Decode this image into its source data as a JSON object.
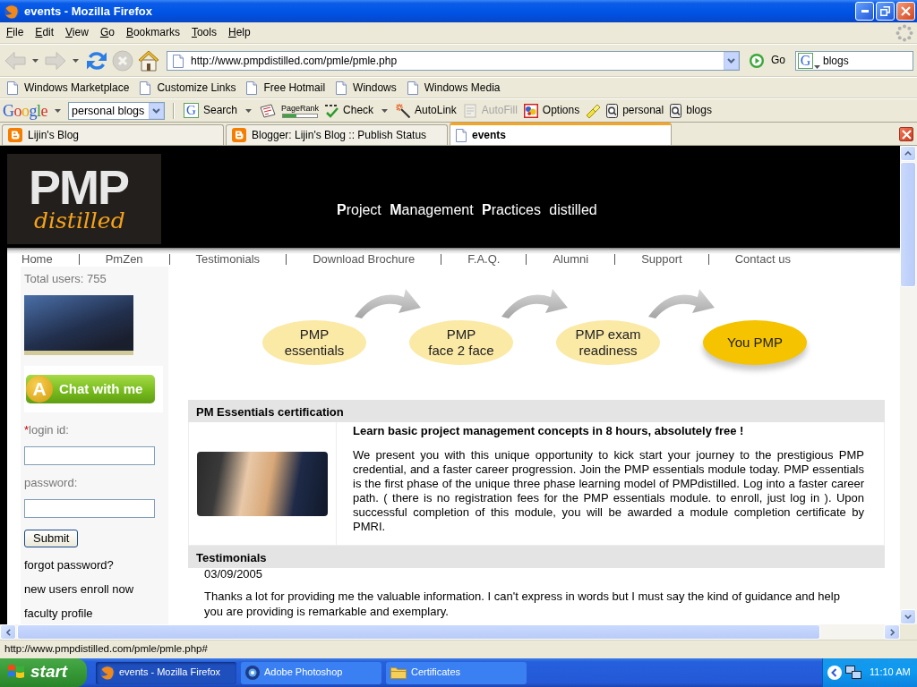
{
  "window": {
    "title": "events - Mozilla Firefox"
  },
  "menu": [
    "File",
    "Edit",
    "View",
    "Go",
    "Bookmarks",
    "Tools",
    "Help"
  ],
  "nav_toolbar": {
    "buttons": [
      {
        "kind": "back",
        "disabled": true,
        "dropdown": true
      },
      {
        "kind": "forward",
        "disabled": true,
        "dropdown": true
      },
      {
        "kind": "reload",
        "disabled": false,
        "dropdown": false
      },
      {
        "kind": "stop",
        "disabled": true,
        "dropdown": false
      },
      {
        "kind": "home",
        "disabled": false,
        "dropdown": false
      }
    ],
    "url": "http://www.pmpdistilled.com/pmle/pmle.php",
    "go": "Go",
    "search": {
      "engine": "G",
      "value": "blogs"
    }
  },
  "bookmarks": [
    "Windows Marketplace",
    "Customize Links",
    "Free Hotmail",
    "Windows",
    "Windows Media"
  ],
  "google_toolbar": {
    "logo": "Google",
    "query": "personal blogs",
    "items": [
      {
        "kind": "search",
        "badge": "G",
        "label": "Search",
        "dropdown": true,
        "disabled": false
      },
      {
        "kind": "news",
        "dropdown": false,
        "disabled": false
      },
      {
        "kind": "pagerank",
        "label": "PageRank",
        "level": 0.4,
        "dropdown": false,
        "disabled": false
      },
      {
        "kind": "spellcheck",
        "label": "Check",
        "dropdown": true,
        "disabled": false
      },
      {
        "kind": "autolink",
        "label": "AutoLink",
        "dropdown": false,
        "disabled": false
      },
      {
        "kind": "autofill",
        "label": "AutoFill",
        "dropdown": false,
        "disabled": true
      },
      {
        "kind": "options",
        "label": "Options",
        "dropdown": false,
        "disabled": false
      },
      {
        "kind": "highlight",
        "dropdown": false,
        "disabled": false
      },
      {
        "kind": "word",
        "label": "personal",
        "dropdown": false,
        "disabled": false
      },
      {
        "kind": "word",
        "label": "blogs",
        "dropdown": false,
        "disabled": false
      }
    ]
  },
  "tabs": [
    {
      "kind": "blog",
      "label": "Lijin's Blog",
      "selected": false
    },
    {
      "kind": "blog",
      "label": "Blogger: Lijin's Blog :: Publish Status",
      "selected": false
    },
    {
      "kind": "page",
      "label": "events",
      "selected": true
    }
  ],
  "page": {
    "logo": {
      "mark": "PMP",
      "script": "distilled"
    },
    "tagline": "**P**roject **M**anagement **P**ractices distilled",
    "nav": [
      "Home",
      "PmZen",
      "Testimonials",
      "Download Brochure",
      "F.A.Q.",
      "Alumni",
      "Support",
      "Contact us"
    ],
    "sidebar": {
      "total_users": "Total users: 755",
      "chat": {
        "badge": "A",
        "label": "Chat with me"
      },
      "required_mark": "*",
      "login_label": "login id:",
      "password_label": "password:",
      "submit": "Submit",
      "links": [
        "forgot password?",
        "new users enroll now",
        "faculty profile"
      ]
    },
    "steps": [
      {
        "label": "PMP\nessentials",
        "selected": false
      },
      {
        "label": "PMP\nface 2 face",
        "selected": false
      },
      {
        "label": "PMP exam\nreadiness",
        "selected": false
      },
      {
        "label": "You PMP",
        "selected": true
      }
    ],
    "sections": [
      {
        "kind": "feature",
        "title": "PM Essentials certification",
        "heading": "Learn basic project management concepts in 8 hours, absolutely free !",
        "body": "We present you with this unique opportunity to kick start your journey to the prestigious PMP credential, and a faster career progression. Join the PMP essentials module today. PMP essentials is the first phase of the unique three phase learning model of PMPdistilled. Log into a faster career path. ( there is no registration fees for the PMP essentials module. to enroll, just log in ). Upon successful completion of this module, you will be awarded a module completion certificate by PMRI."
      },
      {
        "kind": "testimonial",
        "title": "Testimonials",
        "date": "03/09/2005",
        "body": "Thanks a lot for providing me the valuable information. I can't express in words but I must say the kind of guidance and help you are providing is remarkable and exemplary."
      }
    ]
  },
  "status_bar": "http://www.pmpdistilled.com/pmle/pmle.php#",
  "taskbar": {
    "start": "start",
    "tasks": [
      {
        "kind": "browser",
        "label": "events - Mozilla Firefox",
        "selected": true
      },
      {
        "kind": "photoshop",
        "label": "Adobe Photoshop",
        "selected": false
      },
      {
        "kind": "folder",
        "label": "Certificates",
        "selected": false
      }
    ],
    "clock": "11:10 AM"
  }
}
